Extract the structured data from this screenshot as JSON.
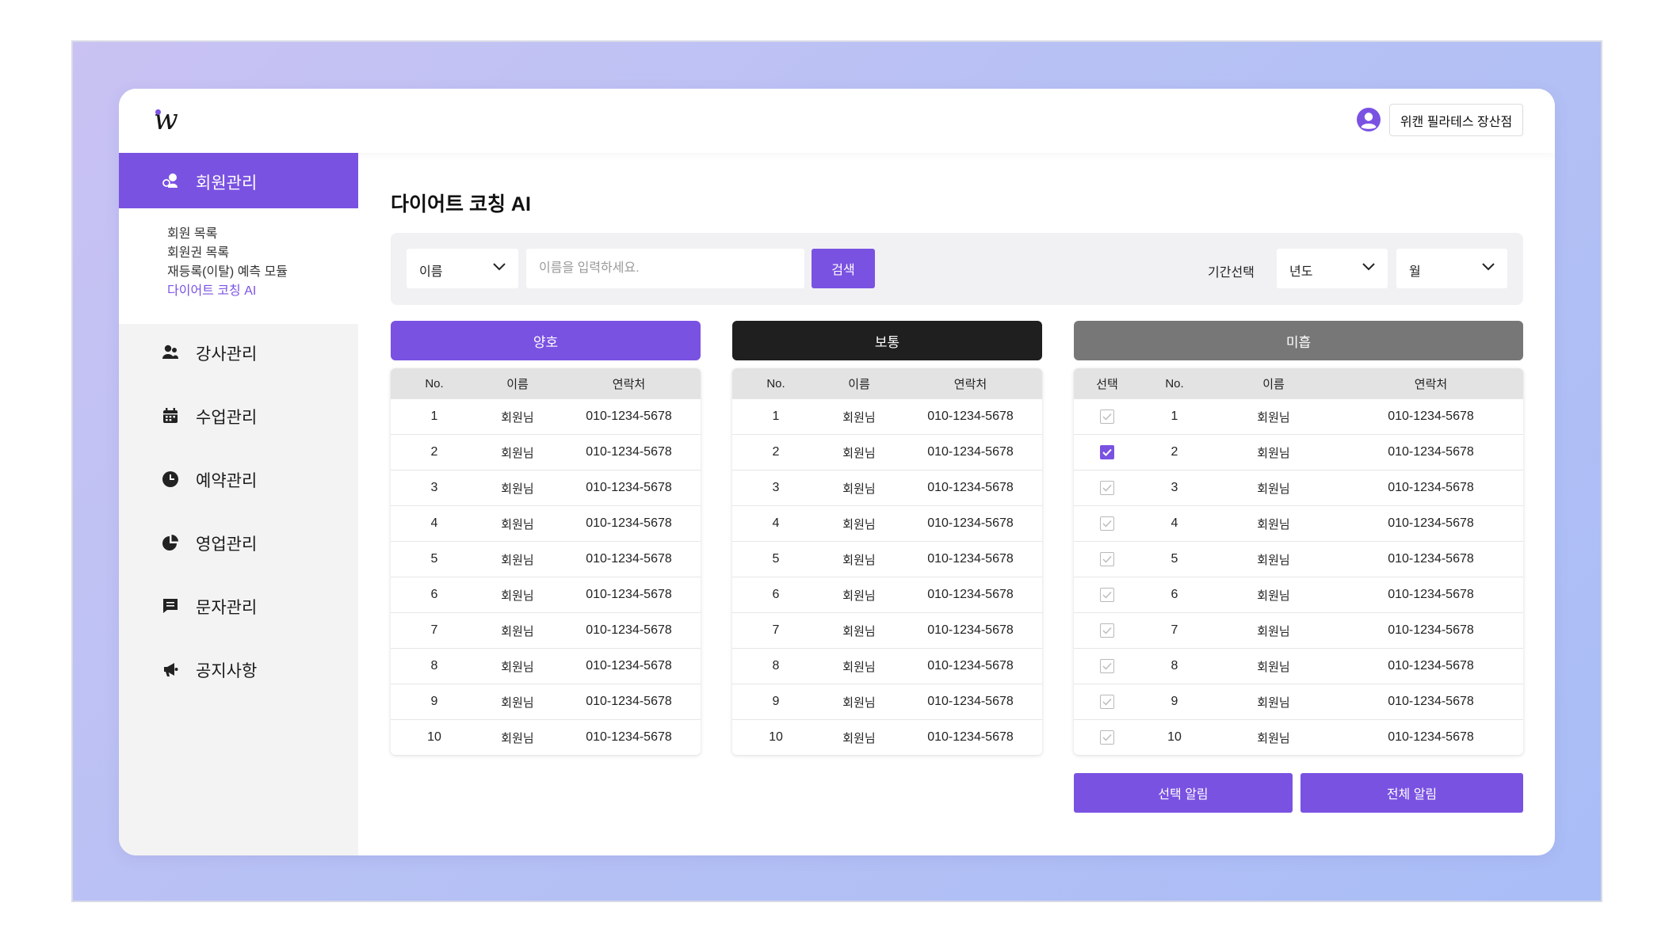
{
  "header": {
    "store_name": "위캔 필라테스 장산점"
  },
  "sidebar": {
    "active": {
      "label": "회원관리",
      "icon": "members-icon"
    },
    "submenu": [
      {
        "label": "회원 목록"
      },
      {
        "label": "회원권 목록"
      },
      {
        "label": "재등록(이탈) 예측 모듈"
      },
      {
        "label": "다이어트 코칭 AI"
      }
    ],
    "items": [
      {
        "label": "강사관리",
        "icon": "instructors-icon"
      },
      {
        "label": "수업관리",
        "icon": "calendar-icon"
      },
      {
        "label": "예약관리",
        "icon": "clock-icon"
      },
      {
        "label": "영업관리",
        "icon": "pie-chart-icon"
      },
      {
        "label": "문자관리",
        "icon": "message-icon"
      },
      {
        "label": "공지사항",
        "icon": "megaphone-icon"
      }
    ]
  },
  "main": {
    "title": "다이어트 코칭 AI",
    "filter": {
      "field_select": "이름",
      "search_placeholder": "이름을 입력하세요.",
      "search_button": "검색",
      "period_label": "기간선택",
      "year_select": "년도",
      "month_select": "월"
    },
    "groups": [
      {
        "label": "양호",
        "color": "#7a52e2"
      },
      {
        "label": "보통",
        "color": "#1f1f1f"
      },
      {
        "label": "미흡",
        "color": "#777777"
      }
    ],
    "columns": {
      "select": "선택",
      "no": "No.",
      "name": "이름",
      "phone": "연락처"
    },
    "rows": [
      {
        "no": "1",
        "name": "회원님",
        "phone": "010-1234-5678",
        "checked": false
      },
      {
        "no": "2",
        "name": "회원님",
        "phone": "010-1234-5678",
        "checked": true
      },
      {
        "no": "3",
        "name": "회원님",
        "phone": "010-1234-5678",
        "checked": false
      },
      {
        "no": "4",
        "name": "회원님",
        "phone": "010-1234-5678",
        "checked": false
      },
      {
        "no": "5",
        "name": "회원님",
        "phone": "010-1234-5678",
        "checked": false
      },
      {
        "no": "6",
        "name": "회원님",
        "phone": "010-1234-5678",
        "checked": false
      },
      {
        "no": "7",
        "name": "회원님",
        "phone": "010-1234-5678",
        "checked": false
      },
      {
        "no": "8",
        "name": "회원님",
        "phone": "010-1234-5678",
        "checked": false
      },
      {
        "no": "9",
        "name": "회원님",
        "phone": "010-1234-5678",
        "checked": false
      },
      {
        "no": "10",
        "name": "회원님",
        "phone": "010-1234-5678",
        "checked": false
      }
    ],
    "actions": {
      "select_notify": "선택 알림",
      "all_notify": "전체 알림"
    }
  },
  "colors": {
    "accent": "#7a52e2",
    "background_gradient": [
      "#c9c2f3",
      "#aabdf6"
    ]
  }
}
